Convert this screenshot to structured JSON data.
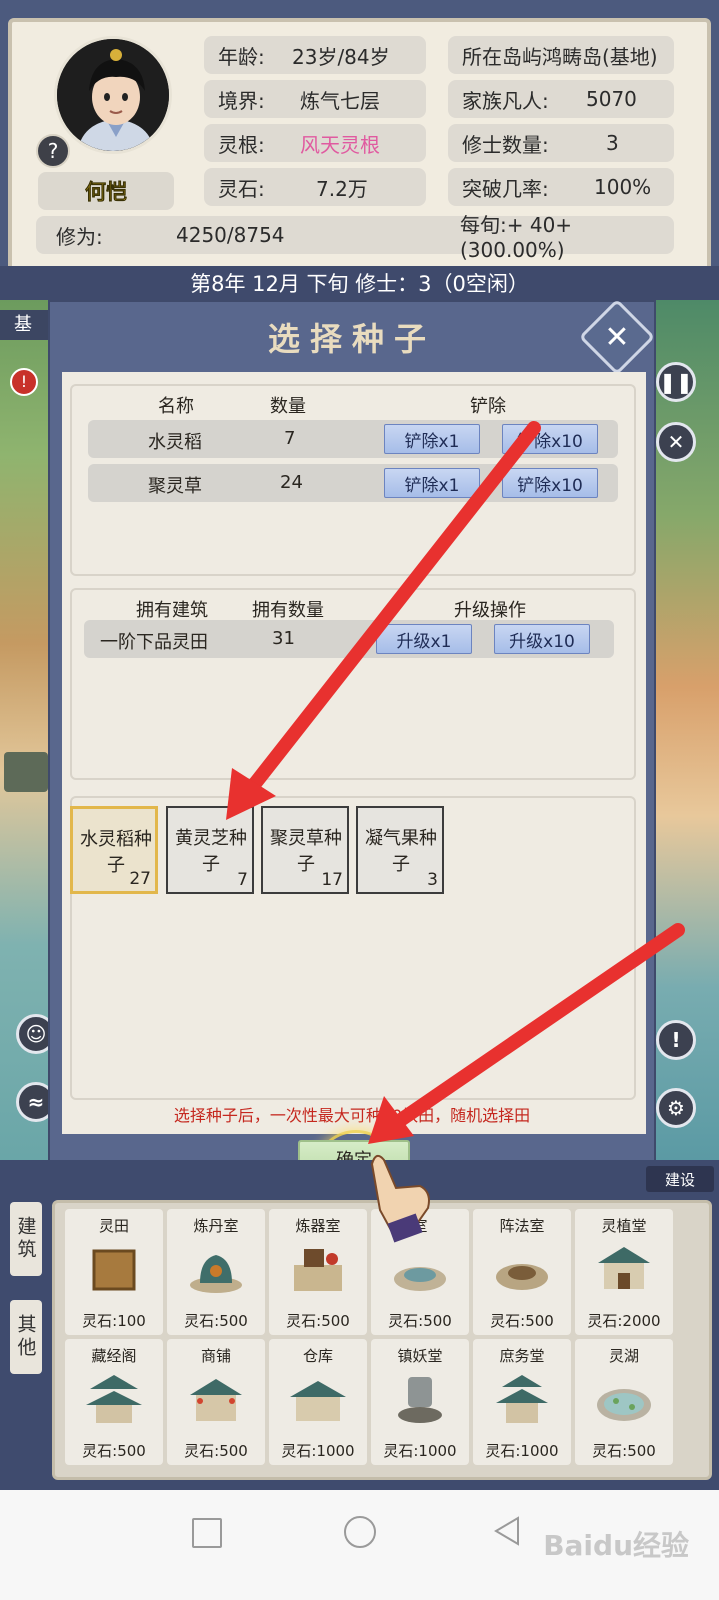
{
  "profile": {
    "name": "何恺",
    "help_icon": "?",
    "age_label": "年龄:",
    "age_value": "23岁/84岁",
    "realm_label": "境界:",
    "realm_value": "炼气七层",
    "root_label": "灵根:",
    "root_value": "风天灵根",
    "stones_label": "灵石:",
    "stones_value": "7.2万",
    "island": "所在岛屿鸿畴岛(基地)",
    "mortals_label": "家族凡人:",
    "mortals_value": "5070",
    "cultivators_label": "修士数量:",
    "cultivators_value": "3",
    "breakthrough_label": "突破几率:",
    "breakthrough_value": "100%",
    "cultivation_label": "修为:",
    "cultivation_value": "4250/8754",
    "rate_text": "每旬:+ 40+(300.00%)"
  },
  "date_bar": "第8年 12月 下旬   修士：3（0空闲）",
  "map_left_labels": [
    "基",
    "!"
  ],
  "dialog": {
    "title": "选择种子",
    "close_icon": "close-x",
    "crops": {
      "headers": [
        "名称",
        "数量",
        "铲除"
      ],
      "rows": [
        {
          "name": "水灵稻",
          "count": "7",
          "btn1": "铲除x1",
          "btn2": "铲除x10"
        },
        {
          "name": "聚灵草",
          "count": "24",
          "btn1": "铲除x1",
          "btn2": "铲除x10"
        }
      ]
    },
    "buildings": {
      "headers": [
        "拥有建筑",
        "拥有数量",
        "升级操作"
      ],
      "rows": [
        {
          "name": "一阶下品灵田",
          "count": "31",
          "btn1": "升级x1",
          "btn2": "升级x10"
        }
      ]
    },
    "seeds": [
      {
        "name_line1": "水灵稻种",
        "name_line2": "子",
        "count": "27",
        "selected": true
      },
      {
        "name_line1": "黄灵芝种",
        "name_line2": "子",
        "count": "7",
        "selected": false
      },
      {
        "name_line1": "聚灵草种",
        "name_line2": "子",
        "count": "17",
        "selected": false
      },
      {
        "name_line1": "凝气果种",
        "name_line2": "子",
        "count": "3",
        "selected": false
      }
    ],
    "hint": "选择种子后，一次性最大可种10块田，随机选择田",
    "confirm_label": "确定"
  },
  "annotation_color": "#e8312f",
  "build_panel": {
    "tabs": [
      "建筑",
      "其他"
    ],
    "built_tag": "建设",
    "tiles": [
      {
        "name": "灵田",
        "cost": "灵石:100"
      },
      {
        "name": "炼丹室",
        "cost": "灵石:500"
      },
      {
        "name": "炼器室",
        "cost": "灵石:500"
      },
      {
        "name": "室",
        "cost": "灵石:500"
      },
      {
        "name": "阵法室",
        "cost": "灵石:500"
      },
      {
        "name": "灵植堂",
        "cost": "灵石:2000"
      },
      {
        "name": "藏经阁",
        "cost": "灵石:500"
      },
      {
        "name": "商铺",
        "cost": "灵石:500"
      },
      {
        "name": "仓库",
        "cost": "灵石:1000"
      },
      {
        "name": "镇妖堂",
        "cost": "灵石:1000"
      },
      {
        "name": "庶务堂",
        "cost": "灵石:1000"
      },
      {
        "name": "灵湖",
        "cost": "灵石:500"
      }
    ]
  },
  "watermark": "Baidu经验"
}
